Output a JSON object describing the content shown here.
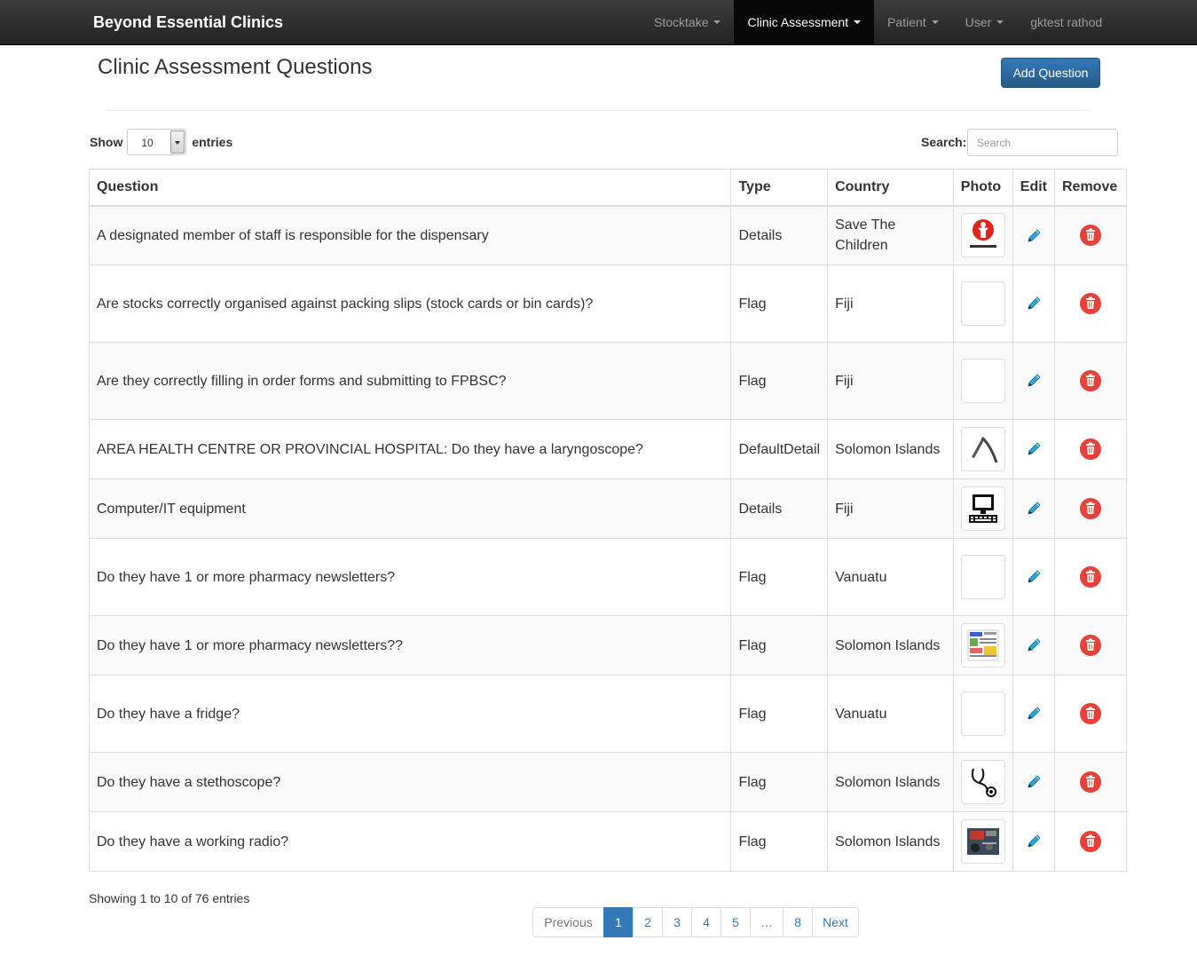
{
  "navbar": {
    "brand": "Beyond Essential Clinics",
    "items": [
      {
        "label": "Stocktake",
        "dropdown": true
      },
      {
        "label": "Clinic Assessment",
        "dropdown": true,
        "active": true
      },
      {
        "label": "Patient",
        "dropdown": true
      },
      {
        "label": "User",
        "dropdown": true
      },
      {
        "label": "gktest rathod",
        "dropdown": false
      }
    ]
  },
  "page": {
    "title": "Clinic Assessment Questions",
    "add_button": "Add Question"
  },
  "controls": {
    "show_label": "Show",
    "entries_value": "10",
    "entries_label": "entries",
    "search_label": "Search:",
    "search_placeholder": "Search"
  },
  "table": {
    "headers": [
      "Question",
      "Type",
      "Country",
      "Photo",
      "Edit",
      "Remove"
    ],
    "rows": [
      {
        "question": "A designated member of staff is responsible for the dispensary",
        "type": "Details",
        "country": "Save The Children",
        "photo": "save-the-children-logo"
      },
      {
        "question": "Are stocks correctly organised against packing slips (stock cards or bin cards)?",
        "type": "Flag",
        "country": "Fiji",
        "photo": "blank"
      },
      {
        "question": "Are they correctly filling in order forms and submitting to FPBSC?",
        "type": "Flag",
        "country": "Fiji",
        "photo": "blank"
      },
      {
        "question": "AREA HEALTH CENTRE OR PROVINCIAL HOSPITAL: Do they have a laryngoscope?",
        "type": "DefaultDetail",
        "country": "Solomon Islands",
        "photo": "laryngoscope"
      },
      {
        "question": "Computer/IT equipment",
        "type": "Details",
        "country": "Fiji",
        "photo": "computer"
      },
      {
        "question": "Do they have 1 or more pharmacy newsletters?",
        "type": "Flag",
        "country": "Vanuatu",
        "photo": "blank"
      },
      {
        "question": "Do they have 1 or more pharmacy newsletters??",
        "type": "Flag",
        "country": "Solomon Islands",
        "photo": "newsletter"
      },
      {
        "question": "Do they have a fridge?",
        "type": "Flag",
        "country": "Vanuatu",
        "photo": "blank"
      },
      {
        "question": "Do they have a stethoscope?",
        "type": "Flag",
        "country": "Solomon Islands",
        "photo": "stethoscope"
      },
      {
        "question": "Do they have a working radio?",
        "type": "Flag",
        "country": "Solomon Islands",
        "photo": "radio"
      }
    ]
  },
  "footer": {
    "info": "Showing 1 to 10 of 76 entries",
    "pages": [
      "Previous",
      "1",
      "2",
      "3",
      "4",
      "5",
      "…",
      "8",
      "Next"
    ],
    "active_page": "1"
  },
  "colors": {
    "primary": "#337ab7",
    "danger": "#e8413a",
    "edit_icon": "#2aa7dd"
  }
}
